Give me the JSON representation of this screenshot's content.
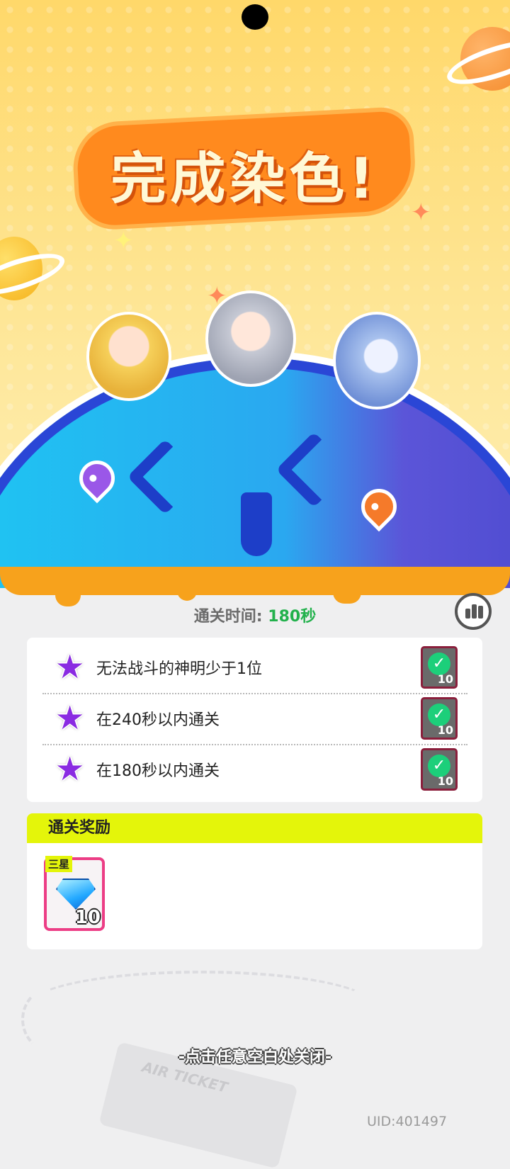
{
  "banner": {
    "title": "完成染色!"
  },
  "result": {
    "clear_time_label": "通关时间:",
    "clear_time_value": "180秒"
  },
  "objectives": [
    {
      "text": "无法战斗的神明少于1位",
      "reward": "10",
      "completed": true
    },
    {
      "text": "在240秒以内通关",
      "reward": "10",
      "completed": true
    },
    {
      "text": "在180秒以内通关",
      "reward": "10",
      "completed": true
    }
  ],
  "rewards": {
    "title": "通关奖励",
    "items": [
      {
        "tag": "三星",
        "icon": "diamond-gem-icon",
        "quantity": "10"
      }
    ]
  },
  "close_hint": "-点击任意空白处关闭-",
  "decor": {
    "ticket_text": "AIR TICKET"
  },
  "uid": "UID:401497",
  "colors": {
    "accent_green": "#22b14c",
    "reward_header": "#e4f50a",
    "star_purple": "#8a2be2",
    "item_border": "#ec3d85"
  }
}
